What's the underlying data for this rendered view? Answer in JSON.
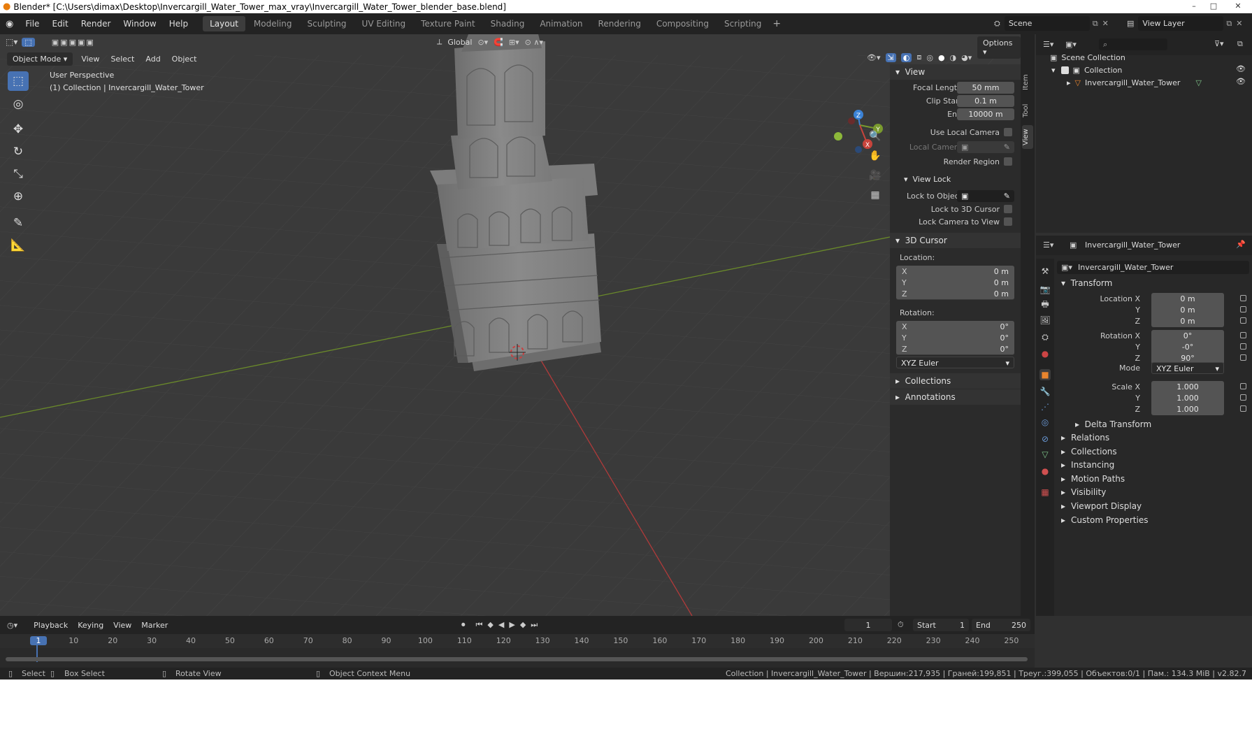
{
  "window": {
    "title": "Blender* [C:\\Users\\dimax\\Desktop\\Invercargill_Water_Tower_max_vray\\Invercargill_Water_Tower_blender_base.blend]"
  },
  "menus": [
    "File",
    "Edit",
    "Render",
    "Window",
    "Help"
  ],
  "workspaces": [
    "Layout",
    "Modeling",
    "Sculpting",
    "UV Editing",
    "Texture Paint",
    "Shading",
    "Animation",
    "Rendering",
    "Compositing",
    "Scripting"
  ],
  "active_workspace": "Layout",
  "scene_field": "Scene",
  "view_layer_field": "View Layer",
  "viewport": {
    "mode": "Object Mode",
    "menus": [
      "View",
      "Select",
      "Add",
      "Object"
    ],
    "orientation": "Global",
    "options": "Options",
    "overlay_title": "User Perspective",
    "overlay_subtitle": "(1) Collection | Invercargill_Water_Tower",
    "gizmo_labels": [
      "Z",
      "Y",
      "X"
    ]
  },
  "npanel": {
    "tabs": [
      "Item",
      "Tool",
      "View"
    ],
    "view_header": "View",
    "focal_length_label": "Focal Length",
    "focal_length": "50 mm",
    "clip_start_label": "Clip Start",
    "clip_start": "0.1 m",
    "clip_end_label": "End",
    "clip_end": "10000 m",
    "use_local_camera": "Use Local Camera",
    "local_camera": "Local Camera",
    "render_region": "Render Region",
    "view_lock_header": "View Lock",
    "lock_to_object": "Lock to Object",
    "lock_to_cursor": "Lock to 3D Cursor",
    "lock_camera": "Lock Camera to View",
    "cursor_header": "3D Cursor",
    "location_label": "Location:",
    "location": [
      {
        "axis": "X",
        "value": "0 m"
      },
      {
        "axis": "Y",
        "value": "0 m"
      },
      {
        "axis": "Z",
        "value": "0 m"
      }
    ],
    "rotation_label": "Rotation:",
    "rotation": [
      {
        "axis": "X",
        "value": "0°"
      },
      {
        "axis": "Y",
        "value": "0°"
      },
      {
        "axis": "Z",
        "value": "0°"
      }
    ],
    "rotation_mode": "XYZ Euler",
    "collections": "Collections",
    "annotations": "Annotations"
  },
  "outliner": {
    "scene_collection": "Scene Collection",
    "collection": "Collection",
    "object": "Invercargill_Water_Tower"
  },
  "properties": {
    "header_name": "Invercargill_Water_Tower",
    "object_name": "Invercargill_Water_Tower",
    "transform_header": "Transform",
    "location_labels": [
      "Location X",
      "Y",
      "Z"
    ],
    "location_values": [
      "0 m",
      "0 m",
      "0 m"
    ],
    "rotation_labels": [
      "Rotation X",
      "Y",
      "Z"
    ],
    "rotation_values": [
      "0°",
      "-0°",
      "90°"
    ],
    "mode_label": "Mode",
    "mode_value": "XYZ Euler",
    "scale_labels": [
      "Scale X",
      "Y",
      "Z"
    ],
    "scale_values": [
      "1.000",
      "1.000",
      "1.000"
    ],
    "delta_transform": "Delta Transform",
    "panels": [
      "Relations",
      "Collections",
      "Instancing",
      "Motion Paths",
      "Visibility",
      "Viewport Display",
      "Custom Properties"
    ]
  },
  "timeline": {
    "menus": [
      "Playback",
      "Keying",
      "View",
      "Marker"
    ],
    "current_frame": "1",
    "start_label": "Start",
    "start": "1",
    "end_label": "End",
    "end": "250",
    "ruler": [
      "1",
      "10",
      "20",
      "30",
      "40",
      "50",
      "60",
      "70",
      "80",
      "90",
      "100",
      "110",
      "120",
      "130",
      "140",
      "150",
      "160",
      "170",
      "180",
      "190",
      "200",
      "210",
      "220",
      "230",
      "240",
      "250"
    ]
  },
  "status": {
    "select": "Select",
    "box_select": "Box Select",
    "rotate_view": "Rotate View",
    "context_menu": "Object Context Menu",
    "info": "Collection | Invercargill_Water_Tower | Вершин:217,935 | Граней:199,851 | Треуг.:399,055 | Объектов:0/1 | Пам.: 134.3 MiB | v2.82.7"
  },
  "colors": {
    "axis_x": "#c8443c",
    "axis_y": "#7a9a2e",
    "axis_z": "#3b82d6",
    "accent_blue": "#4772b3",
    "object_orange": "#e8852e"
  },
  "icons": {
    "tools": [
      "select-box-icon",
      "cursor-icon",
      "move-icon",
      "rotate-icon",
      "scale-icon",
      "transform-icon",
      "annotate-icon",
      "measure-icon"
    ],
    "nav": [
      "zoom-icon",
      "pan-icon",
      "camera-view-icon",
      "ortho-grid-icon"
    ]
  }
}
